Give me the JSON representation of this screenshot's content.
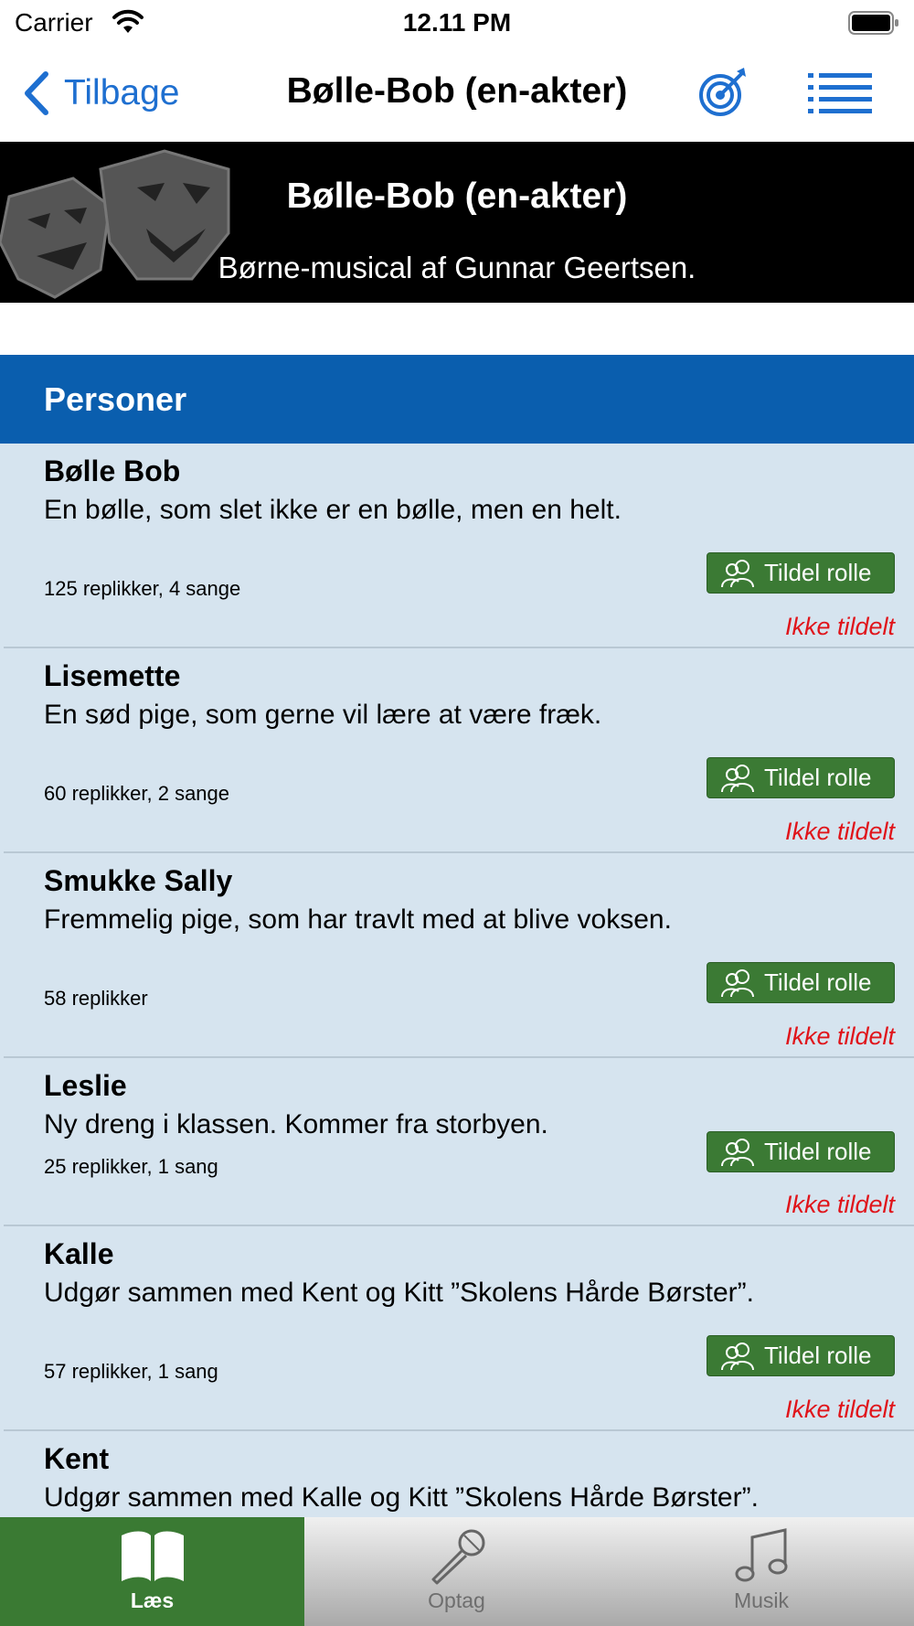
{
  "status_bar": {
    "carrier": "Carrier",
    "time": "12.11 PM"
  },
  "nav": {
    "back_label": "Tilbage",
    "title": "Bølle-Bob (en-akter)"
  },
  "banner": {
    "title": "Bølle-Bob (en-akter)",
    "subtitle": "Børne-musical af Gunnar Geertsen."
  },
  "section": {
    "title": "Personer"
  },
  "characters": [
    {
      "name": "Bølle Bob",
      "description": "En bølle, som slet ikke er en bølle, men en helt.",
      "meta": "125 replikker, 4 sange",
      "button_label": "Tildel rolle",
      "status": "Ikke tildelt"
    },
    {
      "name": "Lisemette",
      "description": "En sød pige, som gerne vil lære at være fræk.",
      "meta": "60 replikker, 2 sange",
      "button_label": "Tildel rolle",
      "status": "Ikke tildelt"
    },
    {
      "name": "Smukke Sally",
      "description": "Fremmelig pige, som har travlt med at blive voksen.",
      "meta": "58 replikker",
      "button_label": "Tildel rolle",
      "status": "Ikke tildelt"
    },
    {
      "name": "Leslie",
      "description": "Ny dreng i klassen. Kommer fra storbyen.",
      "meta": "25 replikker, 1 sang",
      "button_label": "Tildel rolle",
      "status": "Ikke tildelt"
    },
    {
      "name": "Kalle",
      "description": "Udgør sammen med Kent og Kitt ”Skolens Hårde Børster”.",
      "meta": "57 replikker, 1 sang",
      "button_label": "Tildel rolle",
      "status": "Ikke tildelt"
    },
    {
      "name": "Kent",
      "description": "Udgør sammen med Kalle og Kitt ”Skolens Hårde Børster”."
    }
  ],
  "tabs": [
    {
      "label": "Læs",
      "icon": "book-icon",
      "active": true
    },
    {
      "label": "Optag",
      "icon": "microphone-icon",
      "active": false
    },
    {
      "label": "Musik",
      "icon": "music-note-icon",
      "active": false
    }
  ],
  "colors": {
    "accent_blue": "#1e6fd0",
    "section_blue": "#0a5eae",
    "list_background": "#d6e4ef",
    "button_green": "#3b7a34",
    "status_red": "#e0141a",
    "active_tab_green": "#3a7a33"
  }
}
